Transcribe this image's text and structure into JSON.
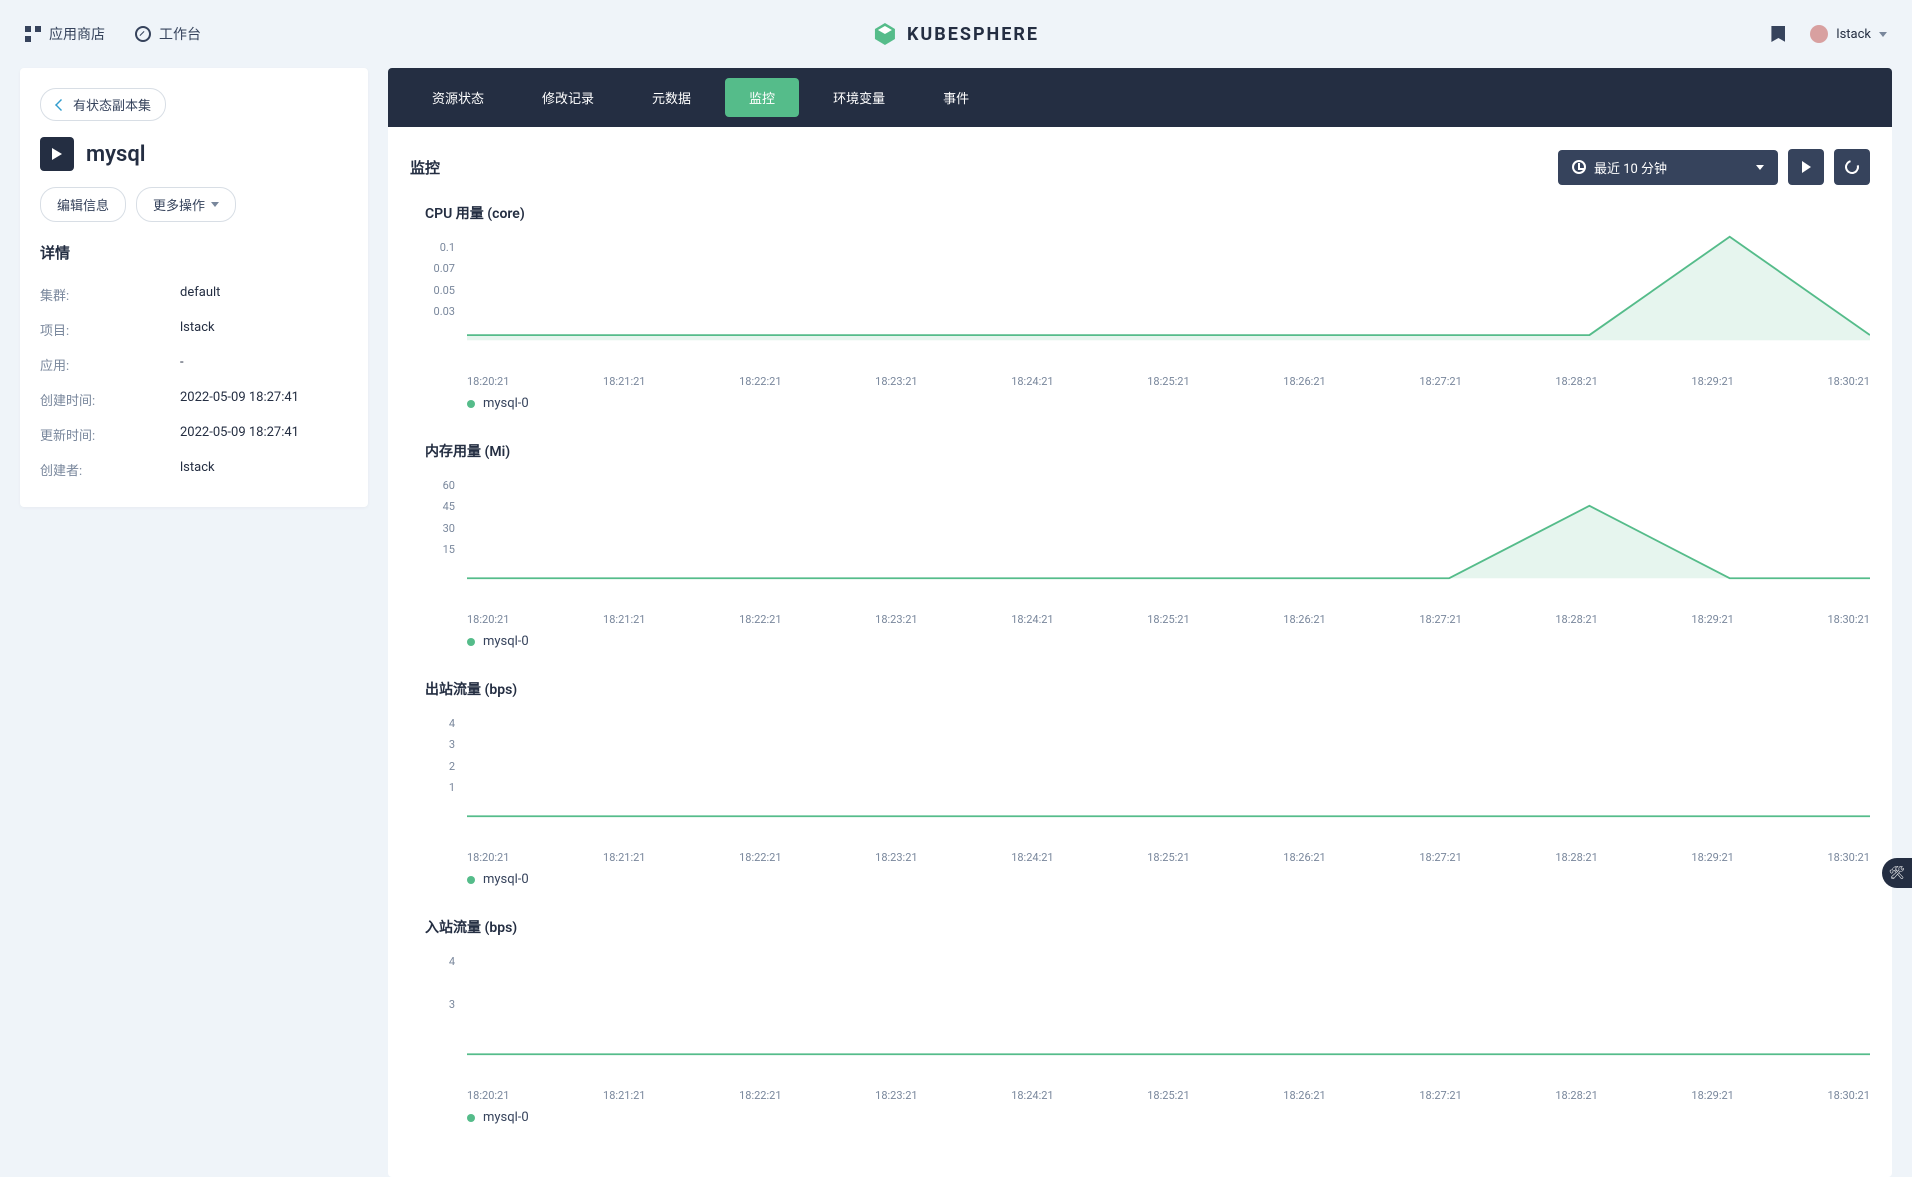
{
  "header": {
    "appstore": "应用商店",
    "workspace": "工作台",
    "brand": "KUBESPHERE",
    "username": "lstack"
  },
  "sidebar": {
    "breadcrumb": "有状态副本集",
    "title": "mysql",
    "edit_btn": "编辑信息",
    "more_btn": "更多操作",
    "details_title": "详情",
    "details": [
      {
        "label": "集群:",
        "value": "default"
      },
      {
        "label": "项目:",
        "value": "lstack"
      },
      {
        "label": "应用:",
        "value": "-"
      },
      {
        "label": "创建时间:",
        "value": "2022-05-09 18:27:41"
      },
      {
        "label": "更新时间:",
        "value": "2022-05-09 18:27:41"
      },
      {
        "label": "创建者:",
        "value": "lstack"
      }
    ]
  },
  "tabs": [
    "资源状态",
    "修改记录",
    "元数据",
    "监控",
    "环境变量",
    "事件"
  ],
  "active_tab": 3,
  "monitor": {
    "title": "监控",
    "timerange": "最近 10 分钟",
    "legend_label": "mysql-0"
  },
  "chart_data": [
    {
      "type": "area",
      "title": "CPU 用量 (core)",
      "yticks": [
        "0.1",
        "0.07",
        "0.05",
        "0.03"
      ],
      "ylim": [
        0,
        0.1
      ],
      "x": [
        "18:20:21",
        "18:21:21",
        "18:22:21",
        "18:23:21",
        "18:24:21",
        "18:25:21",
        "18:26:21",
        "18:27:21",
        "18:28:21",
        "18:29:21",
        "18:30:21"
      ],
      "series": [
        {
          "name": "mysql-0",
          "values": [
            0.005,
            0.005,
            0.005,
            0.005,
            0.005,
            0.005,
            0.005,
            0.005,
            0.005,
            0.1,
            0.005
          ]
        }
      ]
    },
    {
      "type": "area",
      "title": "内存用量 (Mi)",
      "yticks": [
        "60",
        "45",
        "30",
        "15"
      ],
      "ylim": [
        0,
        60
      ],
      "x": [
        "18:20:21",
        "18:21:21",
        "18:22:21",
        "18:23:21",
        "18:24:21",
        "18:25:21",
        "18:26:21",
        "18:27:21",
        "18:28:21",
        "18:29:21",
        "18:30:21"
      ],
      "series": [
        {
          "name": "mysql-0",
          "values": [
            0,
            0,
            0,
            0,
            0,
            0,
            0,
            0,
            42,
            0,
            0
          ]
        }
      ]
    },
    {
      "type": "area",
      "title": "出站流量 (bps)",
      "yticks": [
        "4",
        "3",
        "2",
        "1"
      ],
      "ylim": [
        0,
        4
      ],
      "x": [
        "18:20:21",
        "18:21:21",
        "18:22:21",
        "18:23:21",
        "18:24:21",
        "18:25:21",
        "18:26:21",
        "18:27:21",
        "18:28:21",
        "18:29:21",
        "18:30:21"
      ],
      "series": [
        {
          "name": "mysql-0",
          "values": [
            0,
            0,
            0,
            0,
            0,
            0,
            0,
            0,
            0,
            0,
            0
          ]
        }
      ]
    },
    {
      "type": "area",
      "title": "入站流量 (bps)",
      "yticks": [
        "4",
        "3"
      ],
      "ylim": [
        0,
        4
      ],
      "x": [
        "18:20:21",
        "18:21:21",
        "18:22:21",
        "18:23:21",
        "18:24:21",
        "18:25:21",
        "18:26:21",
        "18:27:21",
        "18:28:21",
        "18:29:21",
        "18:30:21"
      ],
      "series": [
        {
          "name": "mysql-0",
          "values": [
            0,
            0,
            0,
            0,
            0,
            0,
            0,
            0,
            0,
            0,
            0
          ]
        }
      ]
    }
  ]
}
